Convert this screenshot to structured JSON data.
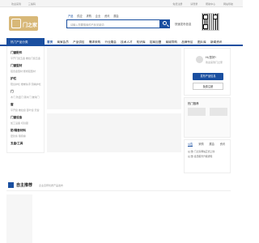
{
  "topbar": {
    "left": [
      "欢迎来到",
      "三编码"
    ],
    "right": [
      "免费注册",
      "请登录",
      "帮助中心",
      "网站导航"
    ]
  },
  "logo": {
    "text": "门之家"
  },
  "search": {
    "tabs": [
      "产品",
      "供应",
      "求购",
      "企业",
      "资讯",
      "展会"
    ],
    "placeholder": "请输入您要搜索的产品关键词",
    "quick_publish": "快速发布信息"
  },
  "nav": {
    "category_header": "热门产品分类",
    "items": [
      "首页",
      "商家会员",
      "产品供应",
      "需求采购",
      "行业展会",
      "技术人才",
      "知识库",
      "招商加盟",
      "商城导购",
      "品牌专区",
      "图片库",
      "新闻资讯"
    ]
  },
  "sidebar": [
    {
      "title": "门窗配件",
      "sub": "平开门窗五金  推拉门窗五金"
    },
    {
      "title": "门窗型材",
      "sub": "铝合金型材  断桥铝型材"
    },
    {
      "title": "护栏",
      "sub": "阳台护栏  楼梯扶手  围墙护栏"
    },
    {
      "title": "门",
      "sub": "木门  防盗门  钢木门  玻璃门"
    },
    {
      "title": "窗",
      "sub": "平开窗  推拉窗  百叶窗  天窗"
    },
    {
      "title": "门窗设备",
      "sub": "加工设备  切割锯"
    },
    {
      "title": "防/隔音材料",
      "sub": "密封条  隔音棉"
    },
    {
      "title": "五金/工具",
      "sub": ""
    }
  ],
  "login_box": {
    "greeting": "Hi,您好!",
    "welcome": "欢迎来到门之家",
    "publish_button": "发布产品信息",
    "register_button": "免费注册"
  },
  "news_panel": {
    "title": "热门推荐"
  },
  "tabs_panel": {
    "tabs": [
      "公告",
      "采购",
      "展会",
      "资讯"
    ],
    "lines": [
      "[公告] 门之家网站正式上线",
      "[公告] 会员服务升级通知"
    ]
  },
  "recommend": {
    "title": "自主推荐",
    "subtitle": "企业自荐优质产品发布"
  },
  "colors": {
    "brand": "#1a4fa0",
    "logo": "#d8b878"
  }
}
